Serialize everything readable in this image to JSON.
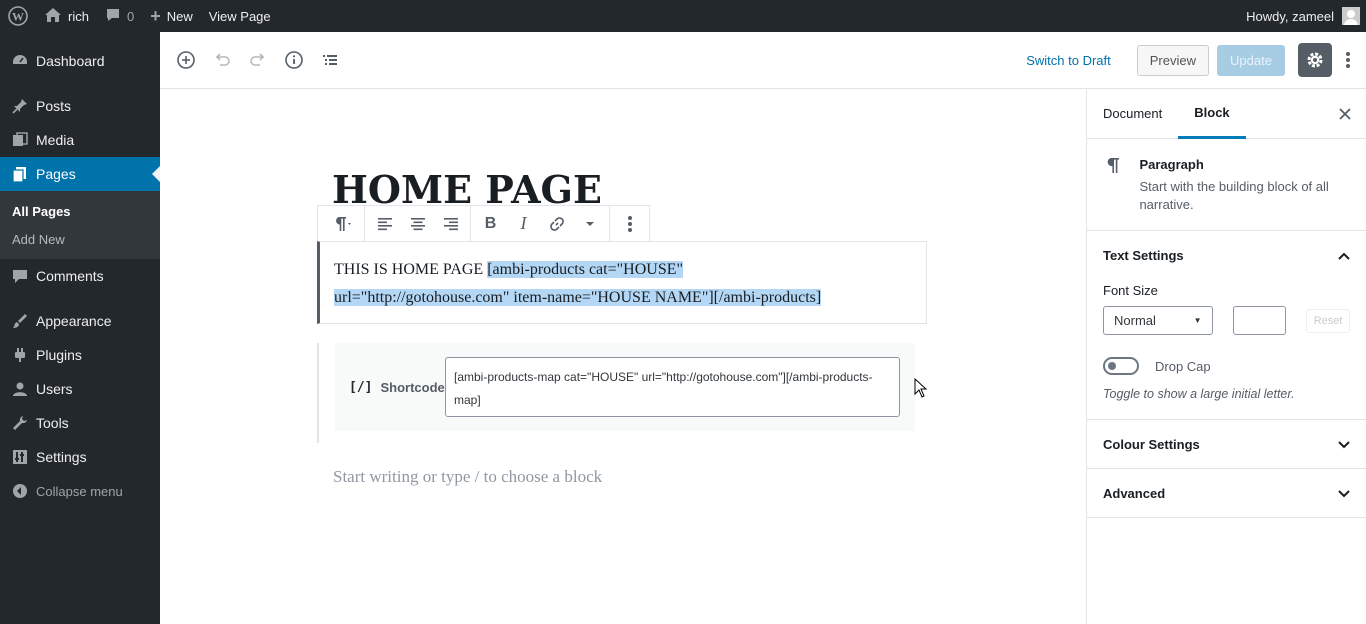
{
  "admin_bar": {
    "site_name": "rich",
    "comments_count": "0",
    "new_label": "New",
    "view_page_label": "View Page",
    "howdy": "Howdy, zameel"
  },
  "admin_menu": {
    "items": [
      {
        "label": "Dashboard",
        "icon": "dashboard-icon"
      },
      {
        "label": "Posts",
        "icon": "pushpin-icon"
      },
      {
        "label": "Media",
        "icon": "media-icon"
      },
      {
        "label": "Pages",
        "icon": "pages-icon"
      },
      {
        "label": "Comments",
        "icon": "comment-icon"
      },
      {
        "label": "Appearance",
        "icon": "paintbrush-icon"
      },
      {
        "label": "Plugins",
        "icon": "plugin-icon"
      },
      {
        "label": "Users",
        "icon": "users-icon"
      },
      {
        "label": "Tools",
        "icon": "wrench-icon"
      },
      {
        "label": "Settings",
        "icon": "settings-icon"
      }
    ],
    "submenu": [
      "All Pages",
      "Add New"
    ],
    "collapse": "Collapse menu"
  },
  "header": {
    "switch_to_draft": "Switch to Draft",
    "preview": "Preview",
    "update": "Update"
  },
  "editor": {
    "page_title": "HOME PAGE",
    "paragraph_plain": "THIS IS HOME PAGE ",
    "paragraph_selected_line1": "[ambi-products cat=\"HOUSE\" ",
    "paragraph_selected_line2": "url=\"http://gotohouse.com\" item-name=\"HOUSE NAME\"][/ambi-products]",
    "shortcode_label": "Shortcode",
    "shortcode_icon": "[/]",
    "shortcode_value": "[ambi-products-map cat=\"HOUSE\" url=\"http://gotohouse.com\"][/ambi-products-map]",
    "placeholder": "Start writing or type / to choose a block"
  },
  "sidebar": {
    "tabs": [
      "Document",
      "Block"
    ],
    "block_name": "Paragraph",
    "block_desc": "Start with the building block of all narrative.",
    "text_settings": "Text Settings",
    "font_size_label": "Font Size",
    "font_size_value": "Normal",
    "reset": "Reset",
    "drop_cap": "Drop Cap",
    "drop_cap_help": "Toggle to show a large initial letter.",
    "colour_settings": "Colour Settings",
    "advanced": "Advanced"
  },
  "colors": {
    "admin_dark": "#23282d",
    "accent": "#0073aa",
    "selection": "#b4d7f5"
  }
}
